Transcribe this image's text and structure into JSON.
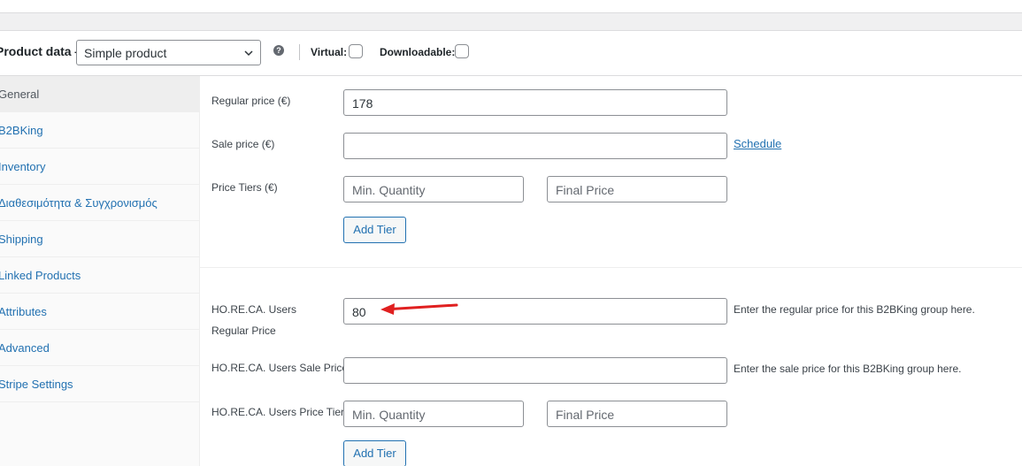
{
  "header": {
    "title": "Product data —",
    "product_type": "Simple product",
    "help_glyph": "?",
    "virtual_label": "Virtual:",
    "downloadable_label": "Downloadable:"
  },
  "sidebar": {
    "items": [
      {
        "label": "General",
        "active": true
      },
      {
        "label": "B2BKing"
      },
      {
        "label": "Inventory"
      },
      {
        "label": "Διαθεσιμότητα & Συγχρονισμός"
      },
      {
        "label": "Shipping"
      },
      {
        "label": "Linked Products"
      },
      {
        "label": "Attributes"
      },
      {
        "label": "Advanced"
      },
      {
        "label": "Stripe Settings"
      }
    ]
  },
  "general": {
    "regular_price_label": "Regular price (€)",
    "regular_price_value": "178",
    "sale_price_label": "Sale price (€)",
    "sale_price_value": "",
    "schedule_link": "Schedule",
    "price_tiers_label": "Price Tiers (€)",
    "min_quantity_placeholder": "Min. Quantity",
    "final_price_placeholder": "Final Price",
    "add_tier_label": "Add Tier"
  },
  "horeca": {
    "regular_label": "HO.RE.CA. Users Regular Price",
    "regular_value": "80",
    "regular_desc": "Enter the regular price for this B2BKing group here.",
    "sale_label": "HO.RE.CA. Users Sale Price",
    "sale_value": "",
    "sale_desc": "Enter the sale price for this B2BKing group here.",
    "tiers_label": "HO.RE.CA. Users Price Tiers",
    "min_quantity_placeholder": "Min. Quantity",
    "final_price_placeholder": "Final Price",
    "add_tier_label": "Add Tier"
  },
  "colors": {
    "accent": "#2271b1",
    "annotation_arrow": "#e02020"
  }
}
